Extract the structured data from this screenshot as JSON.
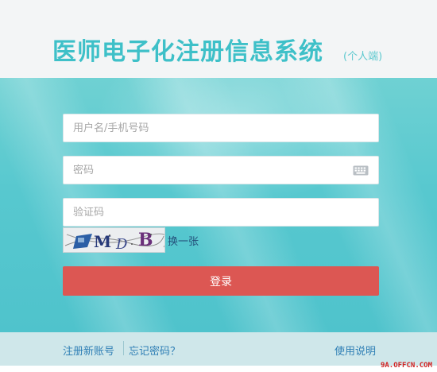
{
  "header": {
    "title": "医师电子化注册信息系统",
    "subtitle": "(个人端)"
  },
  "form": {
    "username_placeholder": "用户名/手机号码",
    "password_placeholder": "密码",
    "captcha_placeholder": "验证码",
    "captcha_text": "MDB",
    "captcha_refresh_label": "换一张",
    "login_label": "登录"
  },
  "footer": {
    "register_label": "注册新账号",
    "forgot_label": "忘记密码？",
    "help_label": "使用说明"
  },
  "watermark": "9A.OFFCN.COM",
  "colors": {
    "title": "#3ec0c8",
    "panel": "#57c8cf",
    "login_button": "#dc5753",
    "link": "#2f7fb5"
  },
  "icons": {
    "password_field": "keyboard-icon"
  }
}
